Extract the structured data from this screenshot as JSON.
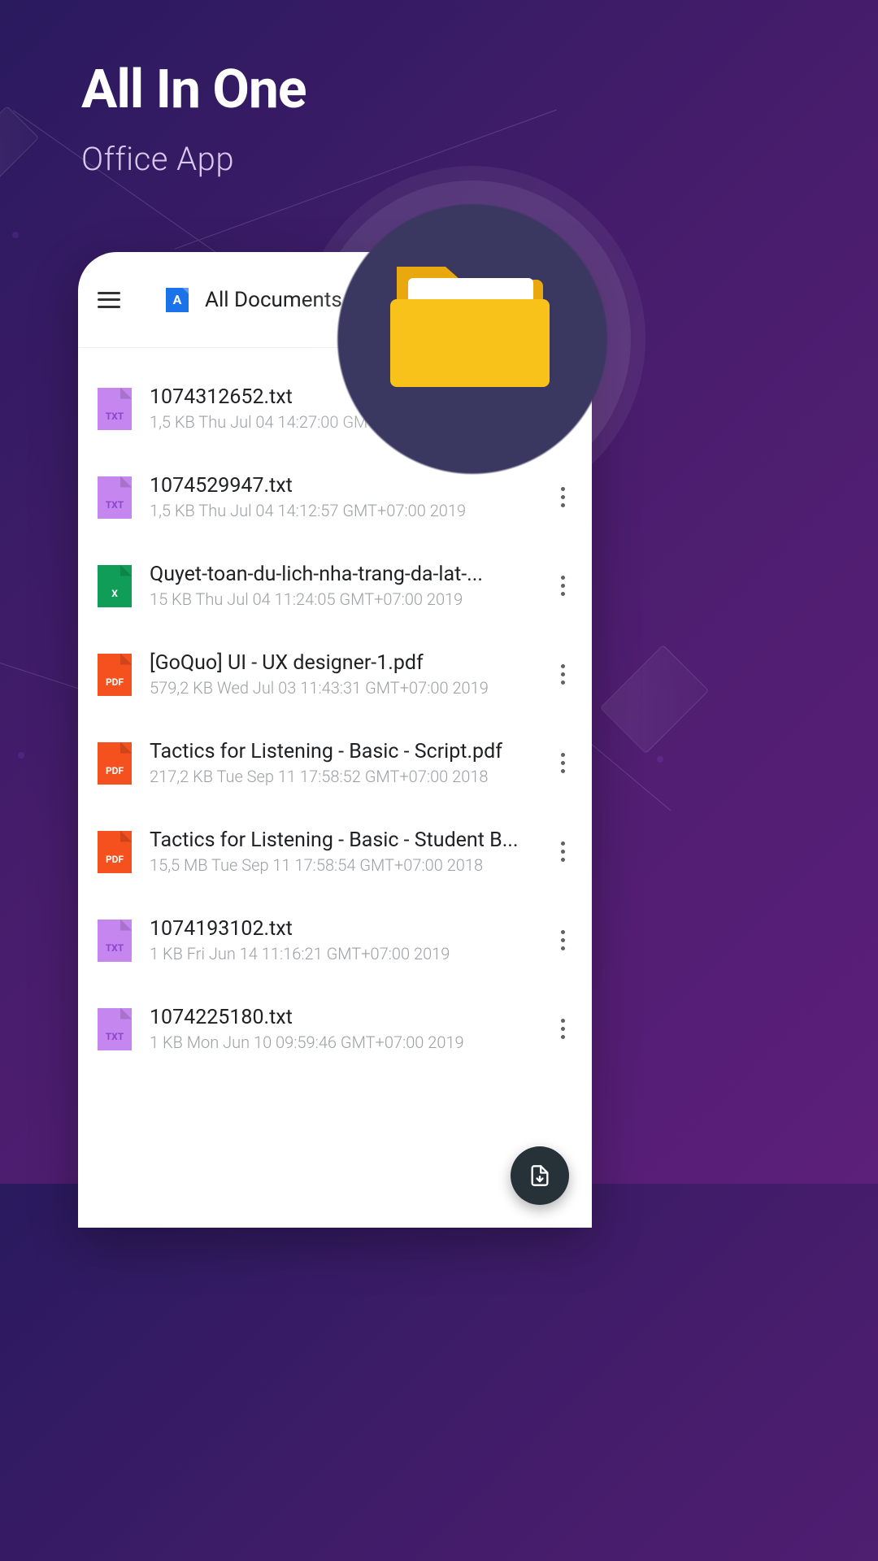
{
  "hero": {
    "title": "All In One",
    "subtitle": "Office App"
  },
  "header": {
    "title": "All Documents",
    "logoLetter": "A"
  },
  "files": [
    {
      "type": "txt",
      "name": "1074312652.txt",
      "meta": "1,5 KB Thu Jul 04 14:27:00 GMT+07:00 2019"
    },
    {
      "type": "txt",
      "name": "1074529947.txt",
      "meta": "1,5 KB Thu Jul 04 14:12:57 GMT+07:00 2019"
    },
    {
      "type": "xls",
      "name": "Quyet-toan-du-lich-nha-trang-da-lat-...",
      "meta": "15 KB Thu Jul 04 11:24:05 GMT+07:00 2019"
    },
    {
      "type": "pdf",
      "name": "[GoQuo] UI - UX designer-1.pdf",
      "meta": "579,2 KB Wed Jul 03 11:43:31 GMT+07:00 2019"
    },
    {
      "type": "pdf",
      "name": "Tactics for Listening - Basic - Script.pdf",
      "meta": "217,2 KB Tue Sep 11 17:58:52 GMT+07:00 2018"
    },
    {
      "type": "pdf",
      "name": "Tactics for Listening - Basic - Student B...",
      "meta": "15,5 MB Tue Sep 11 17:58:54 GMT+07:00 2018"
    },
    {
      "type": "txt",
      "name": "1074193102.txt",
      "meta": "1 KB Fri Jun 14 11:16:21 GMT+07:00 2019"
    },
    {
      "type": "txt",
      "name": "1074225180.txt",
      "meta": "1 KB Mon Jun 10 09:59:46 GMT+07:00 2019"
    }
  ],
  "iconLabels": {
    "txt": "TXT",
    "xls": "X",
    "pdf": "PDF"
  }
}
